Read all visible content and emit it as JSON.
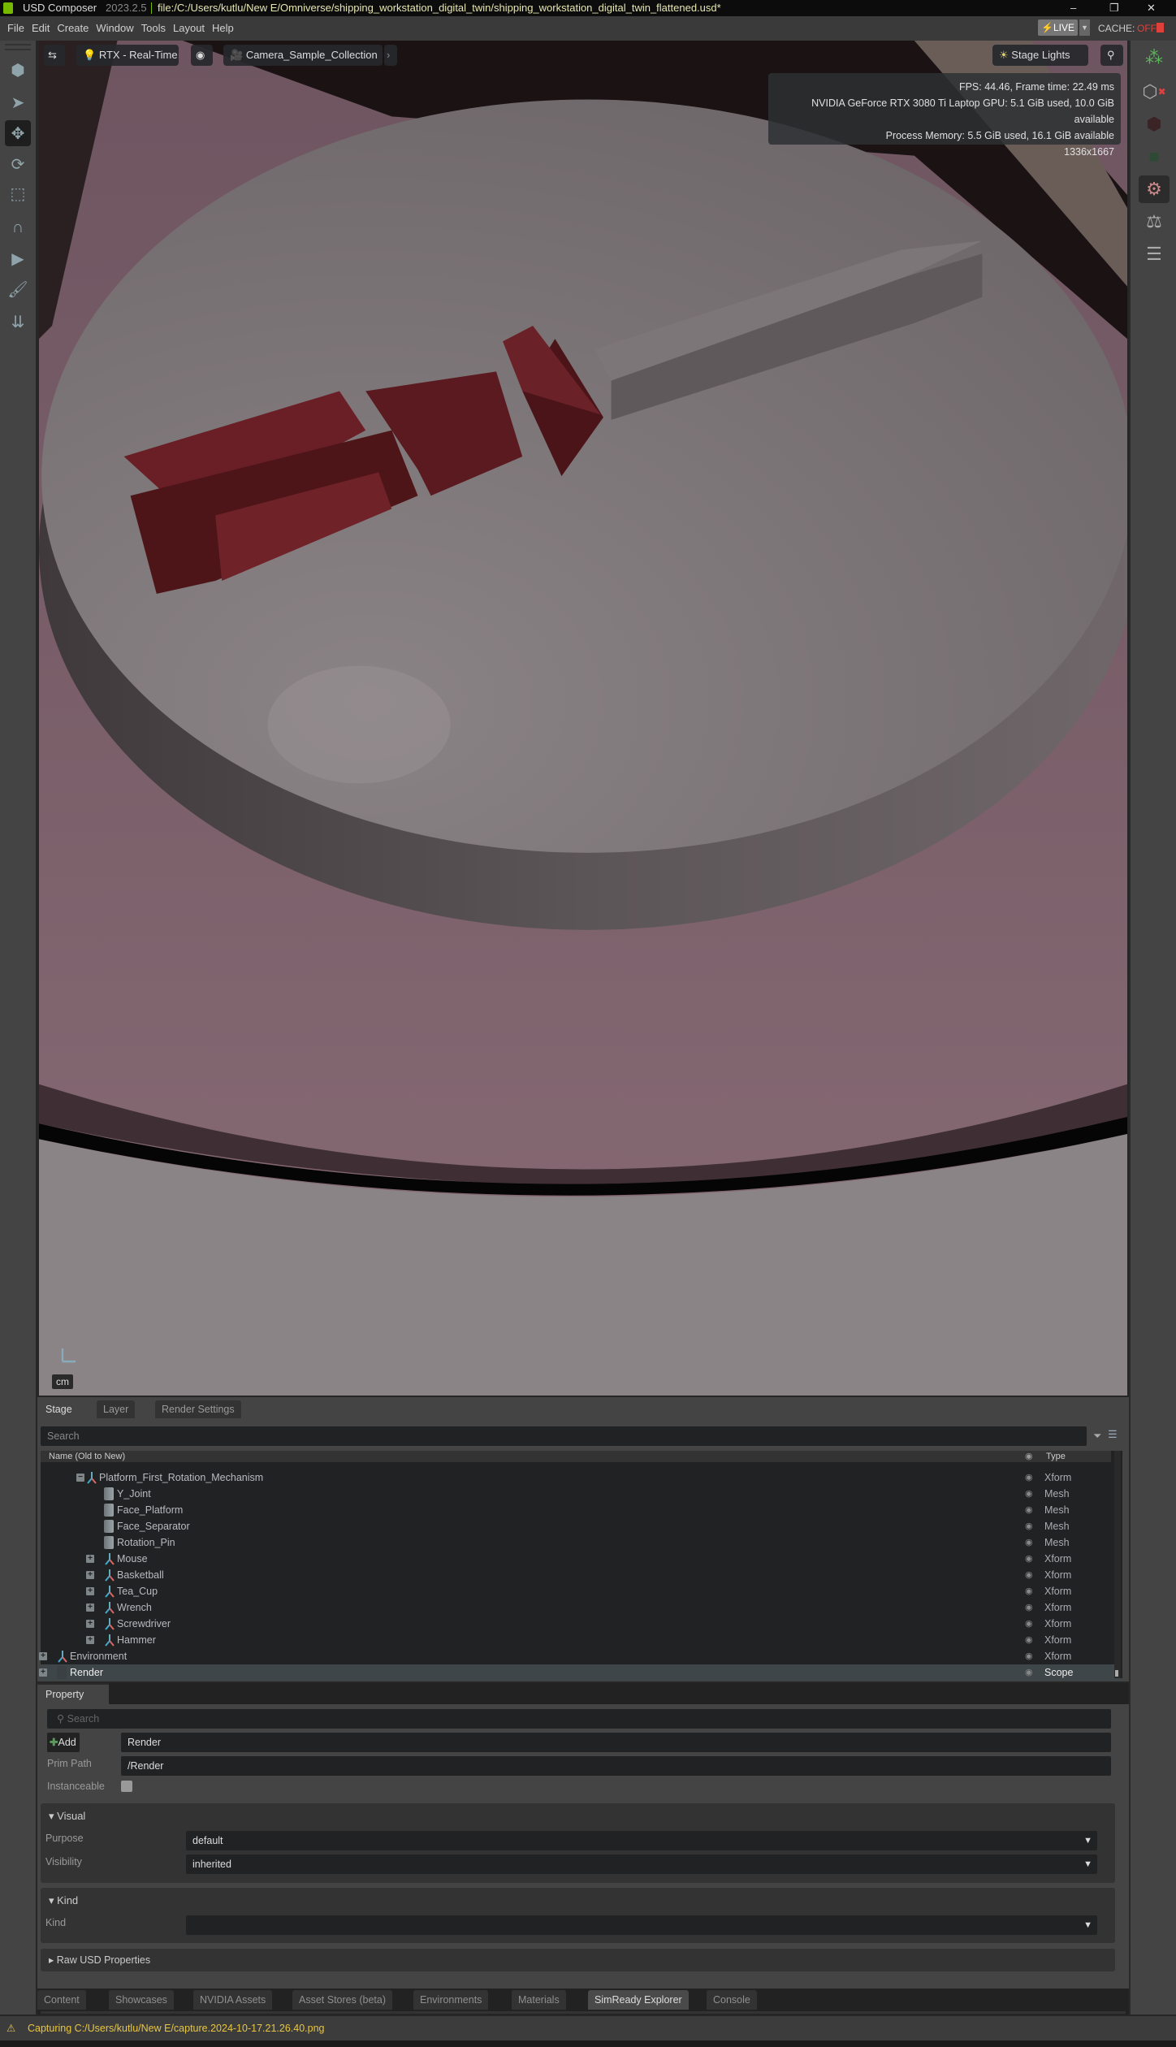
{
  "titlebar": {
    "app": "USD Composer",
    "version": "2023.2.5",
    "file": "file:/C:/Users/kutlu/New E/Omniverse/shipping_workstation_digital_twin/shipping_workstation_digital_twin_flattened.usd*",
    "minimize": "‒",
    "restore": "❐",
    "close": "✕"
  },
  "menu": [
    "File",
    "Edit",
    "Create",
    "Window",
    "Tools",
    "Layout",
    "Help"
  ],
  "live": {
    "label": "LIVE",
    "cache_label": "CACHE:",
    "cache_state": "OFF",
    "cache_color": "#e0403a"
  },
  "viewport": {
    "render_mode": "RTX - Real-Time",
    "camera": "Camera_Sample_Collection",
    "lights": "Stage Lights",
    "stats": [
      "FPS: 44.46, Frame time: 22.49 ms",
      "NVIDIA GeForce RTX 3080 Ti Laptop GPU: 5.1 GiB used, 10.0 GiB available",
      "Process Memory: 5.5 GiB used, 16.1 GiB available",
      "1336x1667"
    ],
    "units": "cm"
  },
  "left_tools": [
    "select-frame",
    "select-arrow",
    "move",
    "rotate",
    "scale",
    "snap",
    "play",
    "paint",
    "drop"
  ],
  "right_tools": [
    "physics-group",
    "clear-physics",
    "rigid-body",
    "collider",
    "physics-settings",
    "mass",
    "sliders"
  ],
  "stage": {
    "tabs": [
      "Stage",
      "Layer",
      "Render Settings"
    ],
    "search_placeholder": "Search",
    "col_name": "Name (Old to New)",
    "col_type": "Type",
    "rows": [
      {
        "name": "Platform_First_Rotation_Mechanism",
        "type": "Xform",
        "kind": "xform",
        "depth": 2,
        "exp": "−"
      },
      {
        "name": "Y_Joint",
        "type": "Mesh",
        "kind": "mesh",
        "depth": 3,
        "exp": ""
      },
      {
        "name": "Face_Platform",
        "type": "Mesh",
        "kind": "mesh",
        "depth": 3,
        "exp": ""
      },
      {
        "name": "Face_Separator",
        "type": "Mesh",
        "kind": "mesh",
        "depth": 3,
        "exp": ""
      },
      {
        "name": "Rotation_Pin",
        "type": "Mesh",
        "kind": "mesh",
        "depth": 3,
        "exp": ""
      },
      {
        "name": "Mouse",
        "type": "Xform",
        "kind": "xform",
        "depth": 3,
        "exp": "+"
      },
      {
        "name": "Basketball",
        "type": "Xform",
        "kind": "xform",
        "depth": 3,
        "exp": "+"
      },
      {
        "name": "Tea_Cup",
        "type": "Xform",
        "kind": "xform",
        "depth": 3,
        "exp": "+"
      },
      {
        "name": "Wrench",
        "type": "Xform",
        "kind": "xform",
        "depth": 3,
        "exp": "+"
      },
      {
        "name": "Screwdriver",
        "type": "Xform",
        "kind": "xform",
        "depth": 3,
        "exp": "+"
      },
      {
        "name": "Hammer",
        "type": "Xform",
        "kind": "xform",
        "depth": 3,
        "exp": "+"
      },
      {
        "name": "Environment",
        "type": "Xform",
        "kind": "xform",
        "depth": 0,
        "exp": "+"
      },
      {
        "name": "Render",
        "type": "Scope",
        "kind": "scope",
        "depth": 0,
        "exp": "+",
        "selected": true
      }
    ]
  },
  "property": {
    "tab": "Property",
    "search_placeholder": "Search",
    "add_label": "Add",
    "name_value": "Render",
    "prim_path_label": "Prim Path",
    "prim_path_value": "/Render",
    "instanceable_label": "Instanceable",
    "visual": {
      "title": "Visual",
      "purpose_label": "Purpose",
      "purpose_value": "default",
      "visibility_label": "Visibility",
      "visibility_value": "inherited"
    },
    "kind": {
      "title": "Kind",
      "kind_label": "Kind",
      "kind_value": ""
    },
    "raw": {
      "title": "Raw USD Properties"
    }
  },
  "bottom_tabs": [
    "Content",
    "Showcases",
    "NVIDIA Assets",
    "Asset Stores (beta)",
    "Environments",
    "Materials",
    "SimReady Explorer",
    "Console"
  ],
  "bottom_active": "SimReady Explorer",
  "status": {
    "message": "Capturing C:/Users/kutlu/New E/capture.2024-10-17.21.26.40.png",
    "color": "#e8c640"
  }
}
